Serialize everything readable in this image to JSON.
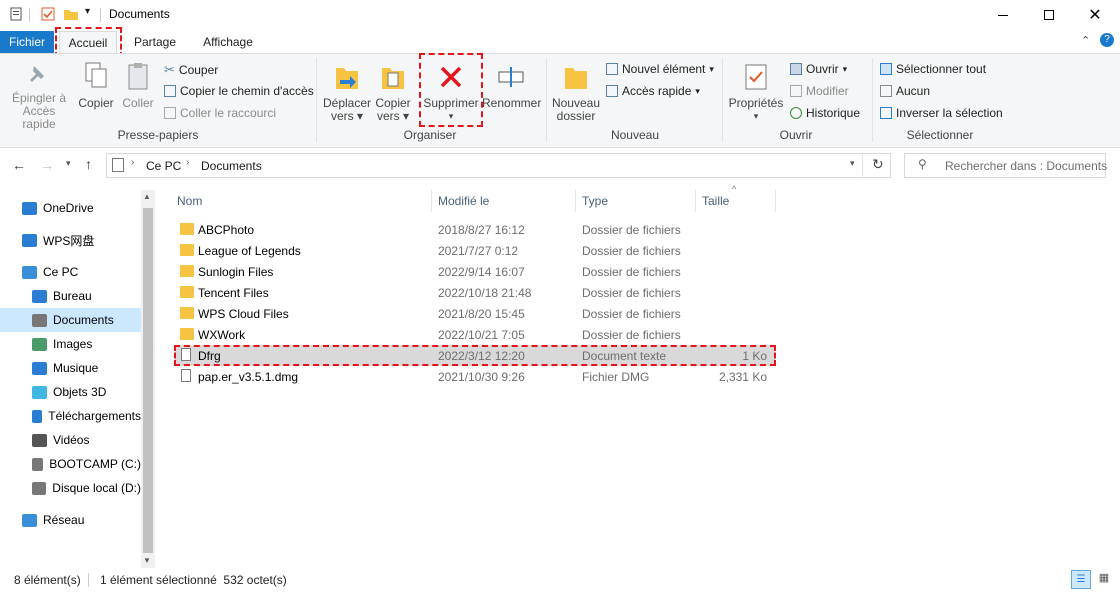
{
  "window": {
    "title": "Documents",
    "minimize_icon": "minimize-icon",
    "maximize_icon": "maximize-icon",
    "close_icon": "close-icon"
  },
  "menu": {
    "file": "Fichier",
    "tabs": [
      "Accueil",
      "Partage",
      "Affichage"
    ]
  },
  "ribbon": {
    "clipboard": {
      "pin": [
        "Épingler à",
        "Accès rapide"
      ],
      "copy": "Copier",
      "paste": "Coller",
      "cut": "Couper",
      "copy_path": "Copier le chemin d'accès",
      "paste_shortcut": "Coller le raccourci",
      "group": "Presse-papiers"
    },
    "organize": {
      "move": [
        "Déplacer",
        "vers"
      ],
      "copy_to": [
        "Copier",
        "vers"
      ],
      "delete": "Supprimer",
      "rename": "Renommer",
      "group": "Organiser"
    },
    "new": {
      "new_folder": [
        "Nouveau",
        "dossier"
      ],
      "new_item": "Nouvel élément",
      "easy_access": "Accès rapide",
      "group": "Nouveau"
    },
    "open": {
      "properties": "Propriétés",
      "open": "Ouvrir",
      "edit": "Modifier",
      "history": "Historique",
      "group": "Ouvrir"
    },
    "select": {
      "select_all": "Sélectionner tout",
      "none": "Aucun",
      "invert": "Inverser la sélection",
      "group": "Sélectionner"
    }
  },
  "address": {
    "crumbs": [
      "Ce PC",
      "Documents"
    ],
    "search_placeholder": "Rechercher dans : Documents"
  },
  "nav": {
    "items": [
      {
        "label": "OneDrive",
        "icon": "cloud-icon"
      },
      {
        "label": "WPS网盘",
        "icon": "cloud-drive-icon"
      },
      {
        "label": "Ce PC",
        "icon": "computer-icon"
      },
      {
        "label": "Bureau",
        "icon": "desktop-icon"
      },
      {
        "label": "Documents",
        "icon": "documents-icon"
      },
      {
        "label": "Images",
        "icon": "images-icon"
      },
      {
        "label": "Musique",
        "icon": "music-icon"
      },
      {
        "label": "Objets 3D",
        "icon": "cube-icon"
      },
      {
        "label": "Téléchargements",
        "icon": "download-icon"
      },
      {
        "label": "Vidéos",
        "icon": "video-icon"
      },
      {
        "label": "BOOTCAMP (C:)",
        "icon": "drive-icon"
      },
      {
        "label": "Disque local (D:)",
        "icon": "drive-icon"
      },
      {
        "label": "Réseau",
        "icon": "network-icon"
      }
    ]
  },
  "columns": [
    "Nom",
    "Modifié le",
    "Type",
    "Taille"
  ],
  "files": [
    {
      "name": "ABCPhoto",
      "date": "2018/8/27 16:12",
      "type": "Dossier de fichiers",
      "size": ""
    },
    {
      "name": "League of Legends",
      "date": "2021/7/27 0:12",
      "type": "Dossier de fichiers",
      "size": ""
    },
    {
      "name": "Sunlogin Files",
      "date": "2022/9/14 16:07",
      "type": "Dossier de fichiers",
      "size": ""
    },
    {
      "name": "Tencent Files",
      "date": "2022/10/18 21:48",
      "type": "Dossier de fichiers",
      "size": ""
    },
    {
      "name": "WPS Cloud Files",
      "date": "2021/8/20 15:45",
      "type": "Dossier de fichiers",
      "size": ""
    },
    {
      "name": "WXWork",
      "date": "2022/10/21 7:05",
      "type": "Dossier de fichiers",
      "size": ""
    },
    {
      "name": "Dfrg",
      "date": "2022/3/12 12:20",
      "type": "Document texte",
      "size": "1 Ko"
    },
    {
      "name": "pap.er_v3.5.1.dmg",
      "date": "2021/10/30 9:26",
      "type": "Fichier DMG",
      "size": "2,331 Ko"
    }
  ],
  "status": {
    "count": "8 élément(s)",
    "selection": "1 élément sélectionné  532 octet(s)"
  },
  "colors": {
    "accent": "#1979ca",
    "highlight": "#e4141b",
    "selection": "#cce8ff"
  }
}
